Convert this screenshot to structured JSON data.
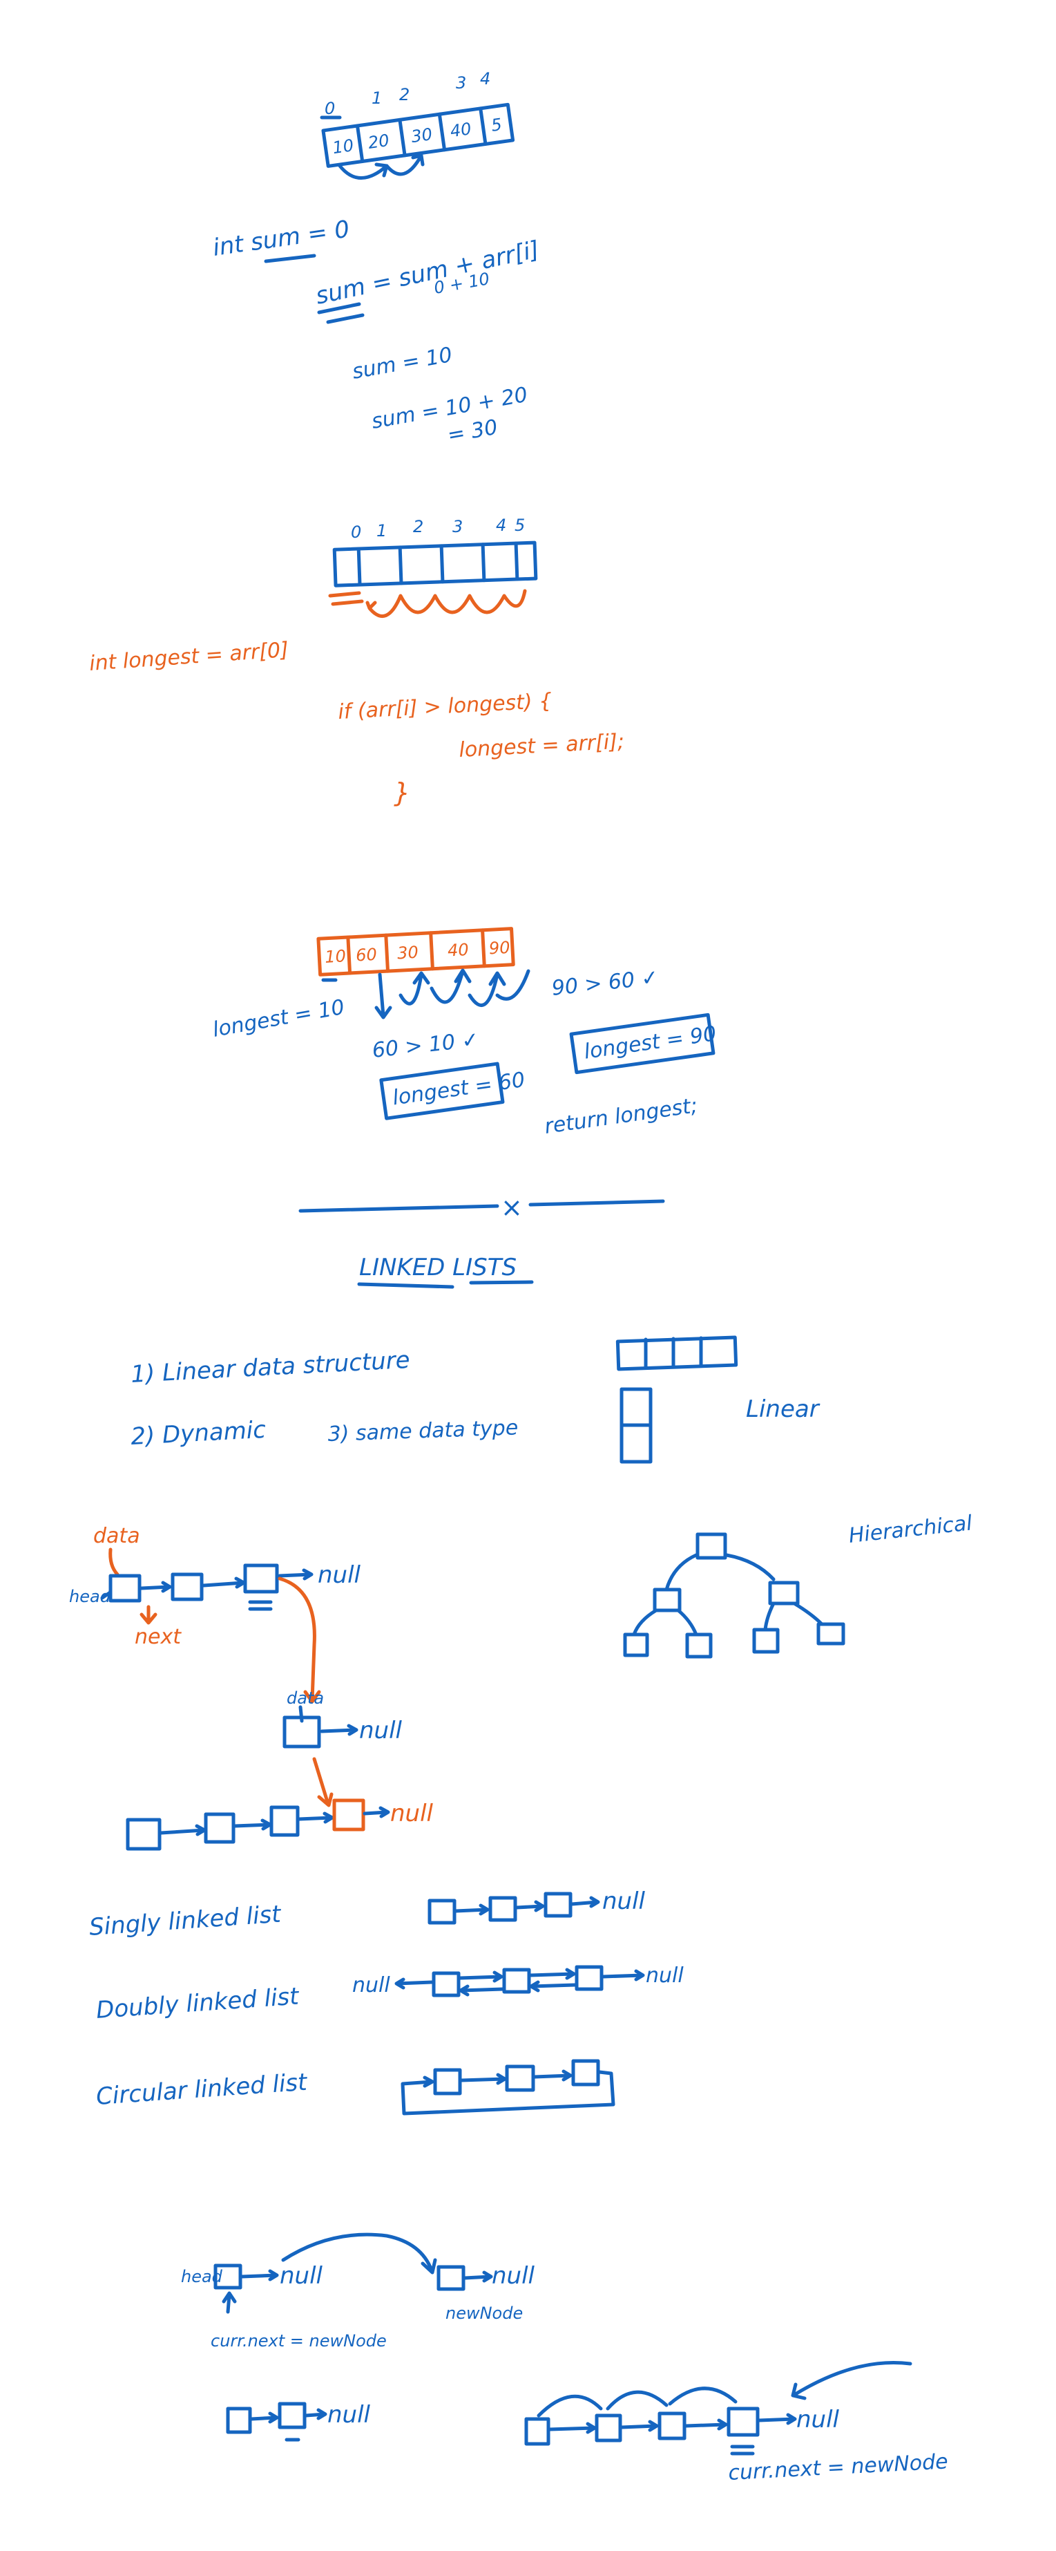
{
  "colors": {
    "blue": "#1565c0",
    "orange": "#e8621f",
    "background": "#ffffff"
  },
  "sum_section": {
    "indices": [
      "0",
      "1",
      "2",
      "3",
      "4"
    ],
    "cells": [
      "10",
      "20",
      "30",
      "40",
      "5"
    ],
    "init": "int sum = 0",
    "formula": "sum = sum + arr[i]",
    "formula_sub": "0 + 10",
    "step1": "sum = 10",
    "step2": "sum = 10 + 20",
    "step2_result": "= 30"
  },
  "longest_section": {
    "indices": [
      "0",
      "1",
      "2",
      "3",
      "4",
      "5"
    ],
    "init": "int longest = arr[0]",
    "if_line": "if (arr[i] > longest) {",
    "body_line": "longest = arr[i];",
    "close_brace": "}"
  },
  "longest_trace": {
    "cells": [
      "10",
      "60",
      "30",
      "40",
      "90"
    ],
    "start": "longest = 10",
    "cmp1": "60 > 10 ✓",
    "box1": "longest = 60",
    "cmp2": "90 > 60 ✓",
    "box2": "longest = 90",
    "return": "return longest;"
  },
  "divider_mark": "×",
  "linked_lists": {
    "heading": "LINKED LISTS",
    "points": [
      "1) Linear data structure",
      "2) Dynamic",
      "3) same data type"
    ],
    "linear_label": "Linear",
    "hierarchical_label": "Hierarchical",
    "data_label": "data",
    "head_label": "head",
    "next_label": "next",
    "null_label": "null",
    "insert_data_label": "data"
  },
  "list_types": {
    "singly": "Singly linked list",
    "doubly": "Doubly linked list",
    "circular": "Circular linked list"
  },
  "insertion": {
    "head_label": "head",
    "null_label": "null",
    "new_node_label": "newNode",
    "assign1": "curr.next = newNode",
    "assign2": "curr.next = newNode"
  }
}
